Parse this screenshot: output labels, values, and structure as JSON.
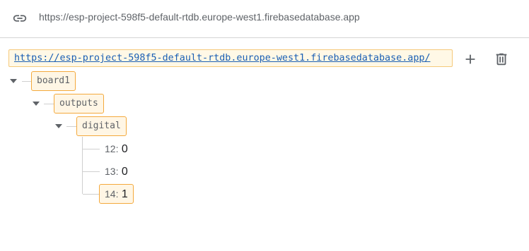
{
  "topbar": {
    "icon": "link-icon",
    "url": "https://esp-project-598f5-default-rtdb.europe-west1.firebasedatabase.app"
  },
  "database": {
    "root_url": "https://esp-project-598f5-default-rtdb.europe-west1.firebasedatabase.app/",
    "actions": {
      "add_icon": "plus-icon",
      "delete_icon": "trash-icon"
    }
  },
  "tree": {
    "board": "board1",
    "outputs": "outputs",
    "digital": "digital",
    "leaves": [
      {
        "key": "12:",
        "value": "0"
      },
      {
        "key": "13:",
        "value": "0"
      },
      {
        "key": "14:",
        "value": "1"
      }
    ]
  },
  "colors": {
    "node_border": "#f4a93c",
    "node_fill": "#fff6e5",
    "link": "#1a5fb4"
  }
}
